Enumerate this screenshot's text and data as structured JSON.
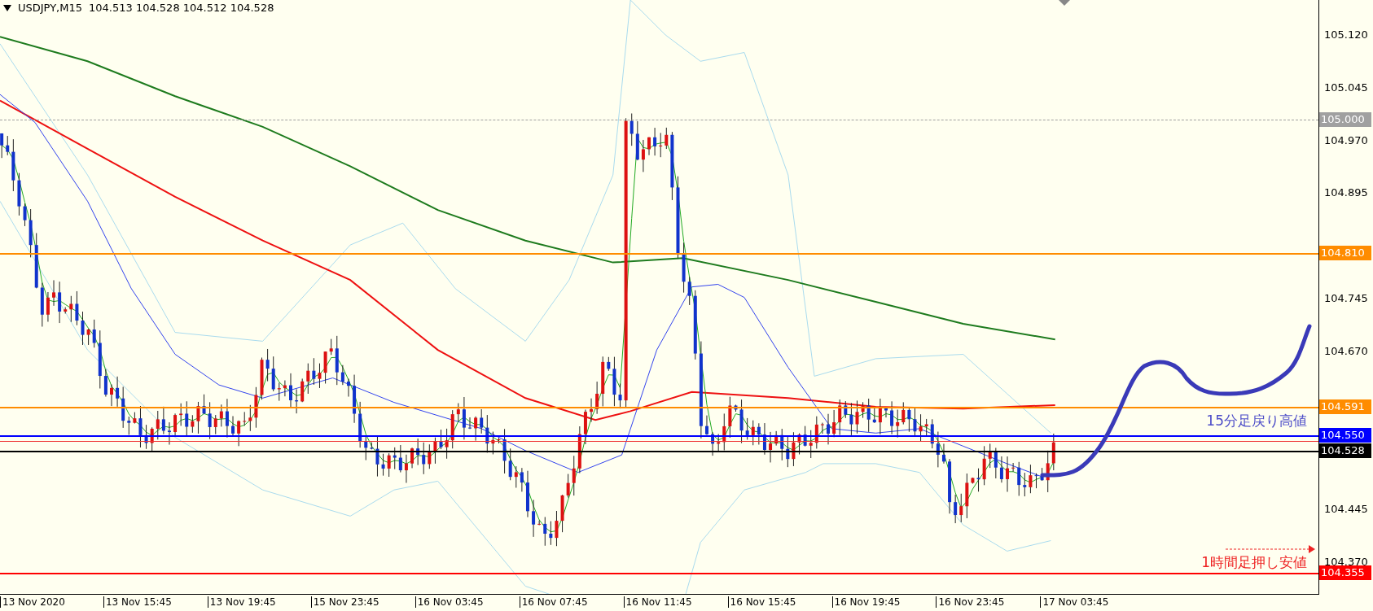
{
  "header": {
    "symbol": "USDJPY,M15",
    "quote": "104.513 104.528 104.512 104.528"
  },
  "price_axis": {
    "ticks": [
      "105.120",
      "105.045",
      "104.970",
      "104.895",
      "104.745",
      "104.670",
      "104.445",
      "104.370"
    ]
  },
  "price_lines": [
    {
      "label": "105.000",
      "color": "#a0a0a0"
    },
    {
      "label": "104.810",
      "color": "#ff8c00"
    },
    {
      "label": "104.591",
      "color": "#ff8c00"
    },
    {
      "label": "104.550",
      "color": "#0000ff"
    },
    {
      "label": "104.528",
      "color": "#000000"
    },
    {
      "label": "104.355",
      "color": "#ff0000"
    }
  ],
  "annotations": [
    {
      "text": "15分足戻り高値",
      "color": "#4d4dc8"
    },
    {
      "text": "1時間足押し安値",
      "color": "#ee2222"
    }
  ],
  "time_axis": {
    "labels": [
      "13 Nov 2020",
      "13 Nov 15:45",
      "13 Nov 19:45",
      "15 Nov 23:45",
      "16 Nov 03:45",
      "16 Nov 07:45",
      "16 Nov 11:45",
      "16 Nov 15:45",
      "16 Nov 19:45",
      "16 Nov 23:45",
      "17 Nov 03:45"
    ]
  }
}
